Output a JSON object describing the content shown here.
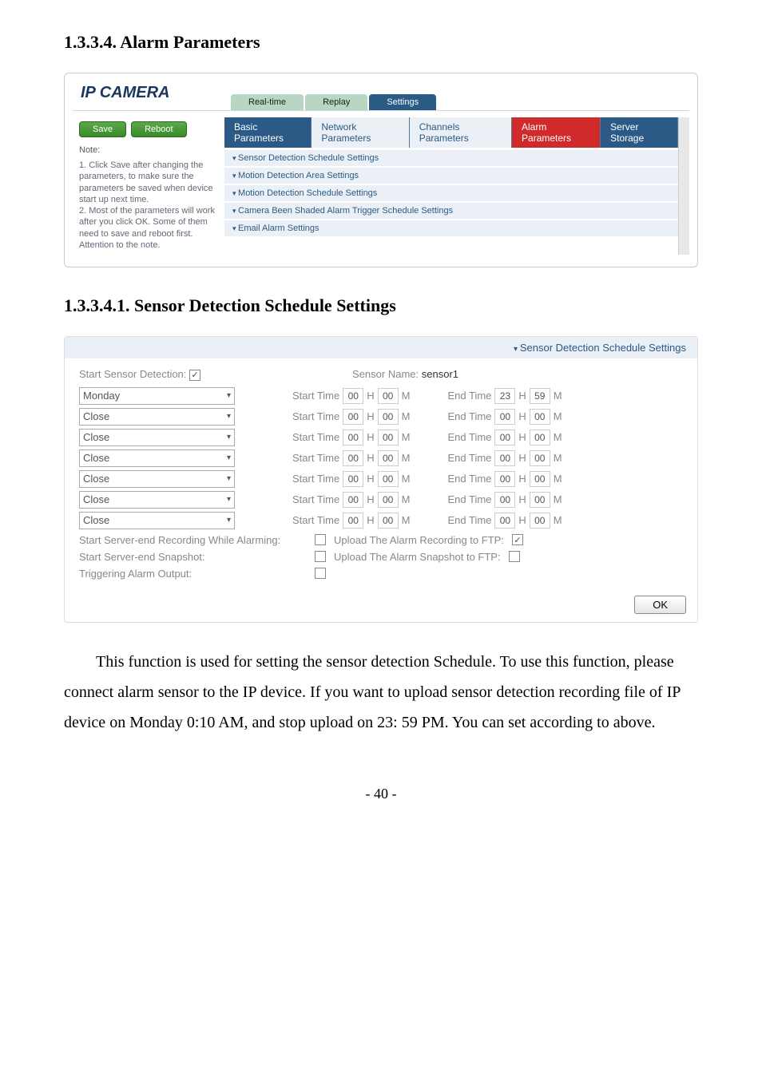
{
  "headings": {
    "h1": "1.3.3.4. Alarm Parameters",
    "h2": "1.3.3.4.1. Sensor Detection Schedule Settings"
  },
  "panel1": {
    "title": "IP CAMERA",
    "tabs": {
      "t1": "Real-time",
      "t2": "Replay",
      "t3": "Settings"
    },
    "buttons": {
      "save": "Save",
      "reboot": "Reboot"
    },
    "note_label": "Note:",
    "note_text": "1. Click Save after changing the parameters, to make sure the parameters be saved when device start up next time.\n2. Most of the parameters will work after you click OK. Some of them need to save and reboot first. Attention to the note.",
    "inner_tabs": {
      "basic": "Basic Parameters",
      "network": "Network Parameters",
      "channels": "Channels Parameters",
      "alarm": "Alarm Parameters",
      "storage": "Server Storage"
    },
    "collapsibles": {
      "c1": "Sensor Detection Schedule Settings",
      "c2": "Motion Detection Area Settings",
      "c3": "Motion Detection Schedule Settings",
      "c4": "Camera Been Shaded Alarm Trigger Schedule Settings",
      "c5": "Email Alarm Settings"
    }
  },
  "panel2": {
    "head": "Sensor Detection Schedule Settings",
    "start_label": "Start Sensor Detection:",
    "sensor_name_label": "Sensor Name:",
    "sensor_name_value": "sensor1",
    "rows": [
      {
        "day": "Monday",
        "sh": "00",
        "sm": "00",
        "eh": "23",
        "em": "59"
      },
      {
        "day": "Close",
        "sh": "00",
        "sm": "00",
        "eh": "00",
        "em": "00"
      },
      {
        "day": "Close",
        "sh": "00",
        "sm": "00",
        "eh": "00",
        "em": "00"
      },
      {
        "day": "Close",
        "sh": "00",
        "sm": "00",
        "eh": "00",
        "em": "00"
      },
      {
        "day": "Close",
        "sh": "00",
        "sm": "00",
        "eh": "00",
        "em": "00"
      },
      {
        "day": "Close",
        "sh": "00",
        "sm": "00",
        "eh": "00",
        "em": "00"
      },
      {
        "day": "Close",
        "sh": "00",
        "sm": "00",
        "eh": "00",
        "em": "00"
      }
    ],
    "labels": {
      "start_time": "Start Time",
      "end_time": "End Time",
      "h": "H",
      "m": "M"
    },
    "flags": {
      "f1l": "Start Server-end Recording While Alarming:",
      "f1r": "Upload The Alarm Recording to FTP:",
      "f2l": "Start Server-end Snapshot:",
      "f2r": "Upload The Alarm Snapshot to FTP:",
      "f3l": "Triggering Alarm Output:"
    },
    "ok": "OK"
  },
  "body_text": "This function is used for setting the sensor detection Schedule. To use this function, please connect alarm sensor to the IP device. If you want to upload sensor detection recording file of IP device on Monday 0:10 AM, and stop upload on 23: 59 PM. You can set according to above.",
  "page_num": "- 40 -"
}
